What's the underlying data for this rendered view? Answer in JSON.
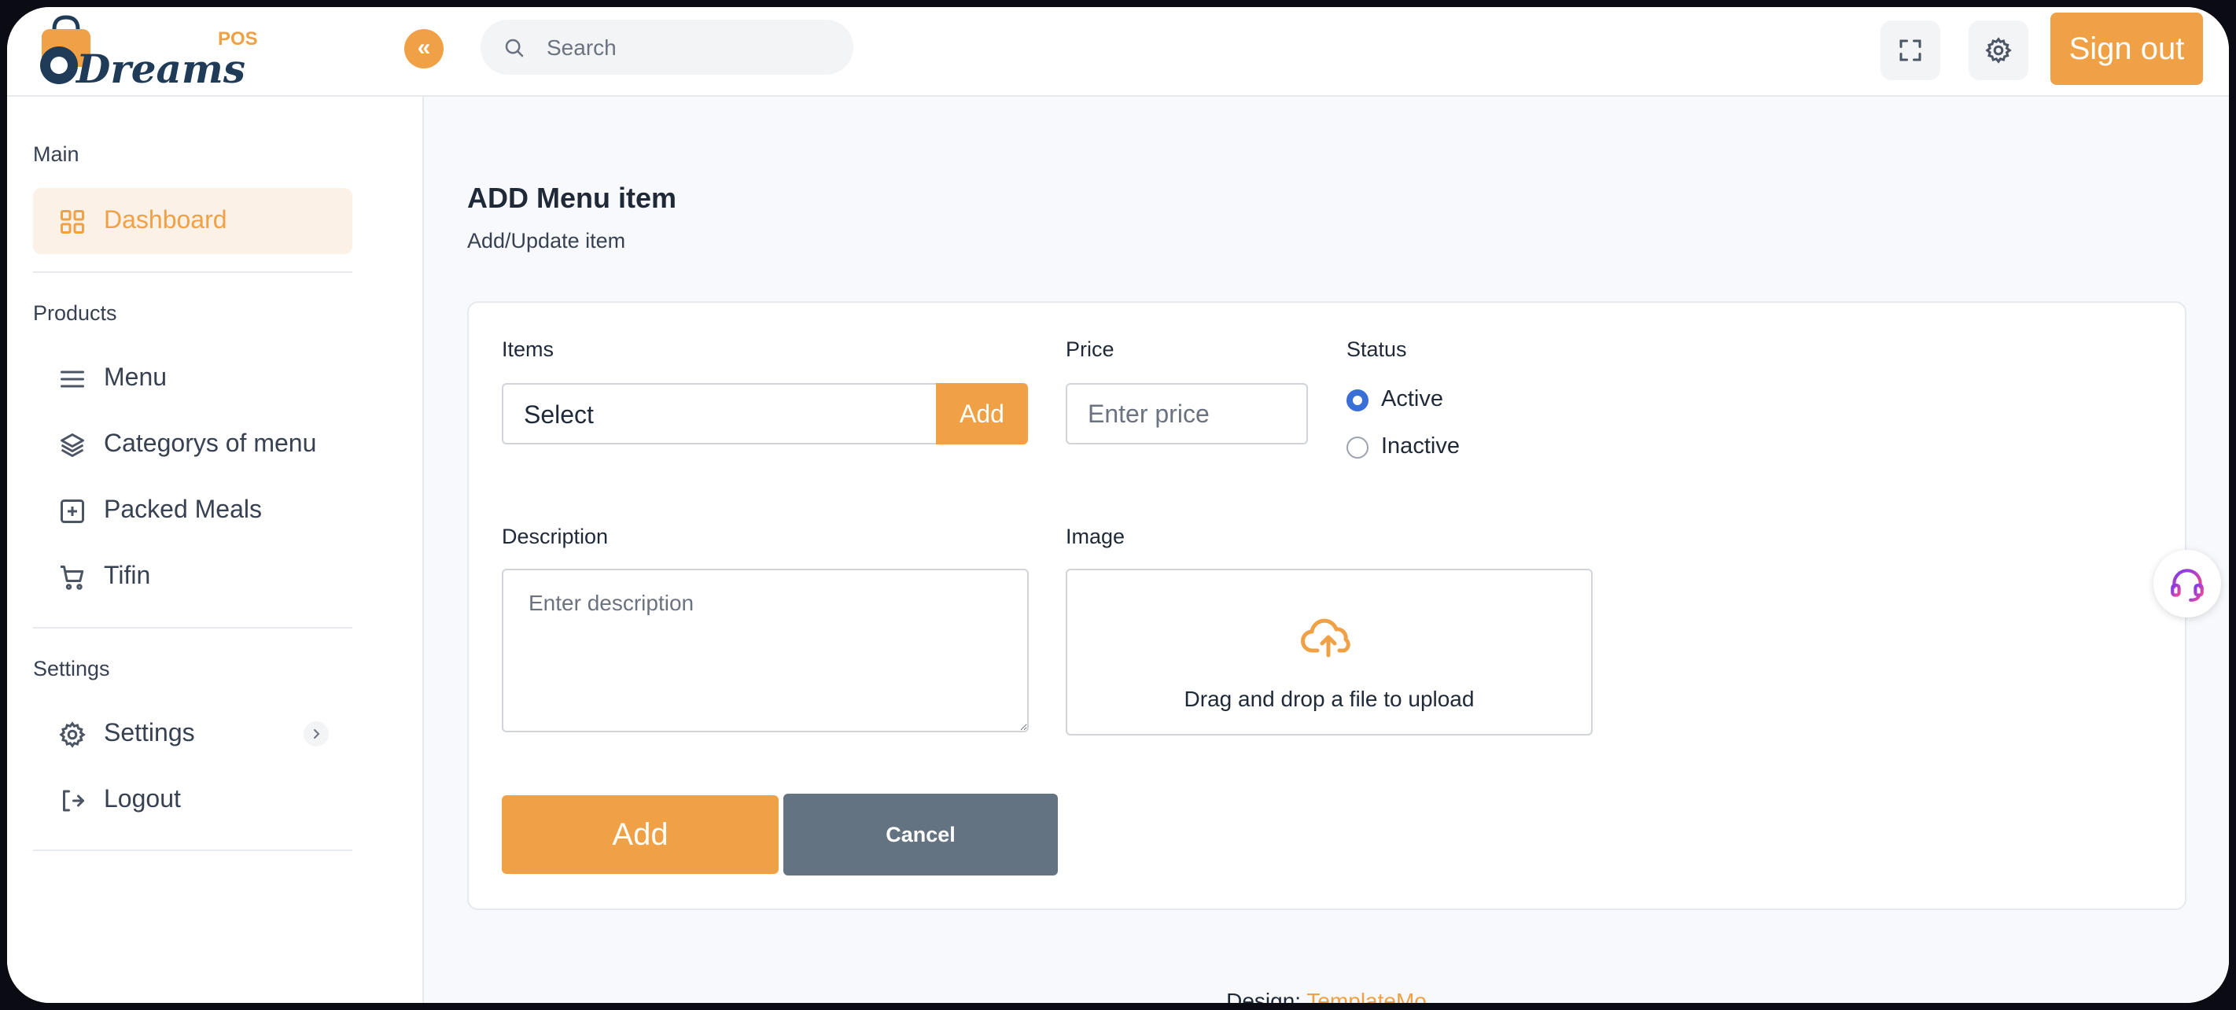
{
  "brand": {
    "logo_text": "Dreams",
    "logo_badge": "POS"
  },
  "header": {
    "search_placeholder": "Search",
    "sign_out": "Sign out"
  },
  "sidebar": {
    "sections": [
      {
        "title": "Main"
      },
      {
        "title": "Products"
      },
      {
        "title": "Settings"
      }
    ],
    "items": [
      {
        "label": "Dashboard",
        "icon": "grid-icon",
        "active": true
      },
      {
        "label": "Menu",
        "icon": "menu-lines-icon"
      },
      {
        "label": "Categorys of menu",
        "icon": "layers-icon"
      },
      {
        "label": "Packed Meals",
        "icon": "plus-square-icon"
      },
      {
        "label": "Tifin",
        "icon": "cart-icon"
      },
      {
        "label": "Settings",
        "icon": "gear-icon"
      },
      {
        "label": "Logout",
        "icon": "logout-icon"
      }
    ]
  },
  "page": {
    "title": "ADD Menu item",
    "subtitle": "Add/Update item"
  },
  "form": {
    "items_label": "Items",
    "items_select_value": "Select",
    "items_add_label": "Add",
    "price_label": "Price",
    "price_placeholder": "Enter price",
    "status_label": "Status",
    "status_options": [
      "Active",
      "Inactive"
    ],
    "status_selected": "Active",
    "description_label": "Description",
    "description_placeholder": "Enter description",
    "image_label": "Image",
    "upload_text": "Drag and drop a file to upload",
    "submit_label": "Add",
    "cancel_label": "Cancel"
  },
  "footer": {
    "prefix": "Design:",
    "link": "TemplateMo"
  },
  "colors": {
    "accent": "#f0a045",
    "cancel": "#637381",
    "radio": "#3b6fd8"
  }
}
